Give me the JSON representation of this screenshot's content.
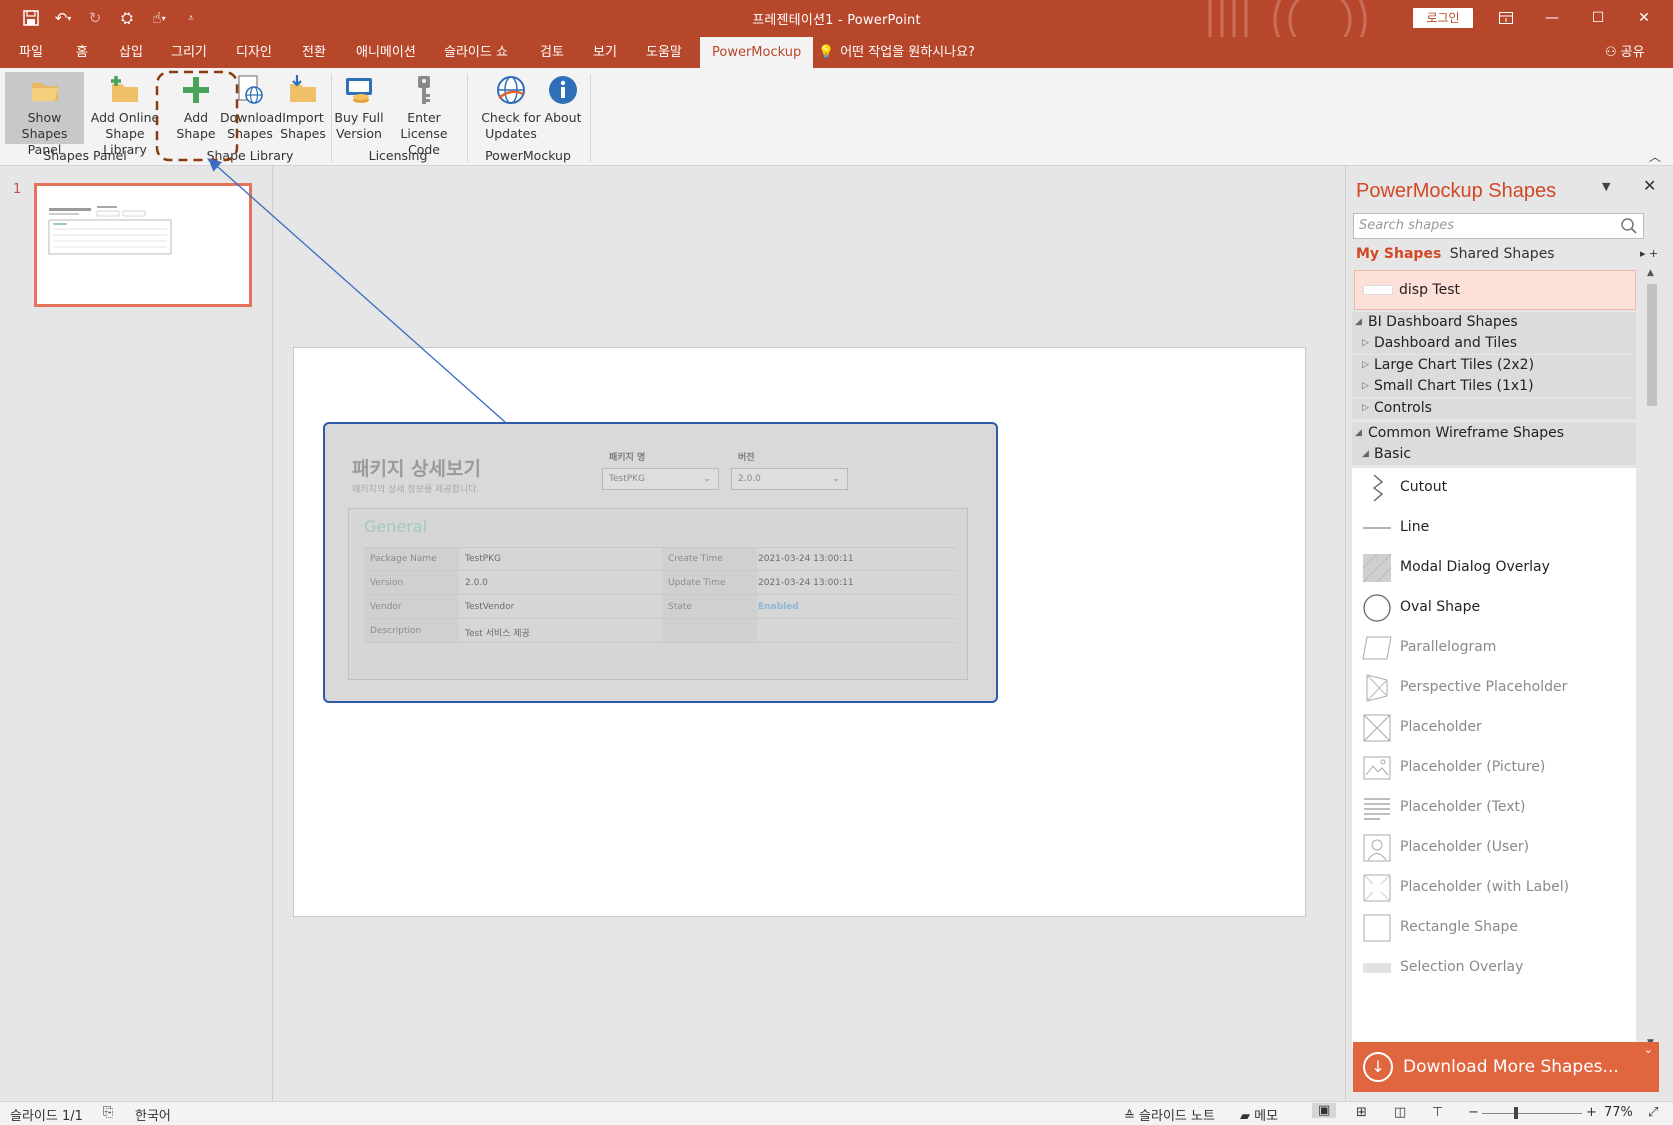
{
  "window": {
    "title": "프레젠테이션1  -  PowerPoint",
    "login_label": "로그인",
    "brand_color": "#b7472a"
  },
  "tabs": [
    {
      "label": "파일"
    },
    {
      "label": "홈"
    },
    {
      "label": "삽입"
    },
    {
      "label": "그리기"
    },
    {
      "label": "디자인"
    },
    {
      "label": "전환"
    },
    {
      "label": "애니메이션"
    },
    {
      "label": "슬라이드 쇼"
    },
    {
      "label": "검토"
    },
    {
      "label": "보기"
    },
    {
      "label": "도움말"
    },
    {
      "label": "PowerMockup",
      "active": true
    }
  ],
  "tell_me": "어떤 작업을 원하시나요?",
  "share_label": "공유",
  "ribbon": {
    "show_shapes_panel": "Show Shapes Panel",
    "show_1": "Show",
    "show_2": "Shapes Panel",
    "add_online_1": "Add Online",
    "add_online_2": "Shape Library",
    "add_shape_1": "Add",
    "add_shape_2": "Shape",
    "download_1": "Download",
    "download_2": "Shapes",
    "import_1": "Import",
    "import_2": "Shapes",
    "buy_1": "Buy Full",
    "buy_2": "Version",
    "license_1": "Enter License",
    "license_2": "Code",
    "check_1": "Check for",
    "check_2": "Updates",
    "about": "About",
    "groups": {
      "shapes_panel": "Shapes Panel",
      "shape_library": "Shape Library",
      "licensing": "Licensing",
      "powermockup": "PowerMockup"
    }
  },
  "thumbnails": {
    "slide_number": "1"
  },
  "mockup": {
    "title": "패키지 상세보기",
    "subtitle": "패키지의 상세 정보를 제공합니다.",
    "package_label": "패키지 명",
    "package_value": "TestPKG",
    "version_label": "버전",
    "version_value": "2.0.0",
    "section": "General",
    "rows_left": [
      {
        "key": "Package Name",
        "value": "TestPKG"
      },
      {
        "key": "Version",
        "value": "2.0.0"
      },
      {
        "key": "Vendor",
        "value": "TestVendor"
      },
      {
        "key": "Description",
        "value": "Test 서비스 제공"
      }
    ],
    "rows_right": [
      {
        "key": "Create Time",
        "value": "2021-03-24 13:00:11"
      },
      {
        "key": "Update Time",
        "value": "2021-03-24 13:00:11"
      },
      {
        "key": "State",
        "value": "Enabled"
      }
    ]
  },
  "shapes_panel": {
    "title": "PowerMockup Shapes",
    "search_placeholder": "Search shapes",
    "tab_my": "My Shapes",
    "tab_shared": "Shared Shapes",
    "my_shape": "disp Test",
    "categories": [
      {
        "label": "BI Dashboard Shapes",
        "state": "expanded"
      },
      {
        "label": "Dashboard and Tiles",
        "state": "collapsed"
      },
      {
        "label": "Large Chart Tiles (2x2)",
        "state": "collapsed"
      },
      {
        "label": "Small Chart Tiles (1x1)",
        "state": "collapsed"
      },
      {
        "label": "Controls",
        "state": "collapsed"
      },
      {
        "label": "Common Wireframe Shapes",
        "state": "expanded"
      },
      {
        "label": "Basic",
        "state": "expanded"
      }
    ],
    "shapes": [
      {
        "label": "Cutout",
        "icon": "cutout-icon"
      },
      {
        "label": "Line",
        "icon": "line-icon"
      },
      {
        "label": "Modal Dialog Overlay",
        "icon": "modal-overlay-icon"
      },
      {
        "label": "Oval Shape",
        "icon": "oval-icon"
      },
      {
        "label": "Parallelogram",
        "icon": "parallelogram-icon"
      },
      {
        "label": "Perspective Placeholder",
        "icon": "perspective-placeholder-icon"
      },
      {
        "label": "Placeholder",
        "icon": "placeholder-icon"
      },
      {
        "label": "Placeholder (Picture)",
        "icon": "picture-placeholder-icon"
      },
      {
        "label": "Placeholder (Text)",
        "icon": "text-placeholder-icon"
      },
      {
        "label": "Placeholder (User)",
        "icon": "user-placeholder-icon"
      },
      {
        "label": "Placeholder (with Label)",
        "icon": "label-placeholder-icon"
      },
      {
        "label": "Rectangle Shape",
        "icon": "rectangle-icon"
      },
      {
        "label": "Selection Overlay",
        "icon": "selection-overlay-icon"
      }
    ],
    "download_more": "Download More Shapes..."
  },
  "status": {
    "slide": "슬라이드 1/1",
    "language": "한국어",
    "notes": "슬라이드 노트",
    "comments": "메모",
    "zoom": "77%"
  }
}
